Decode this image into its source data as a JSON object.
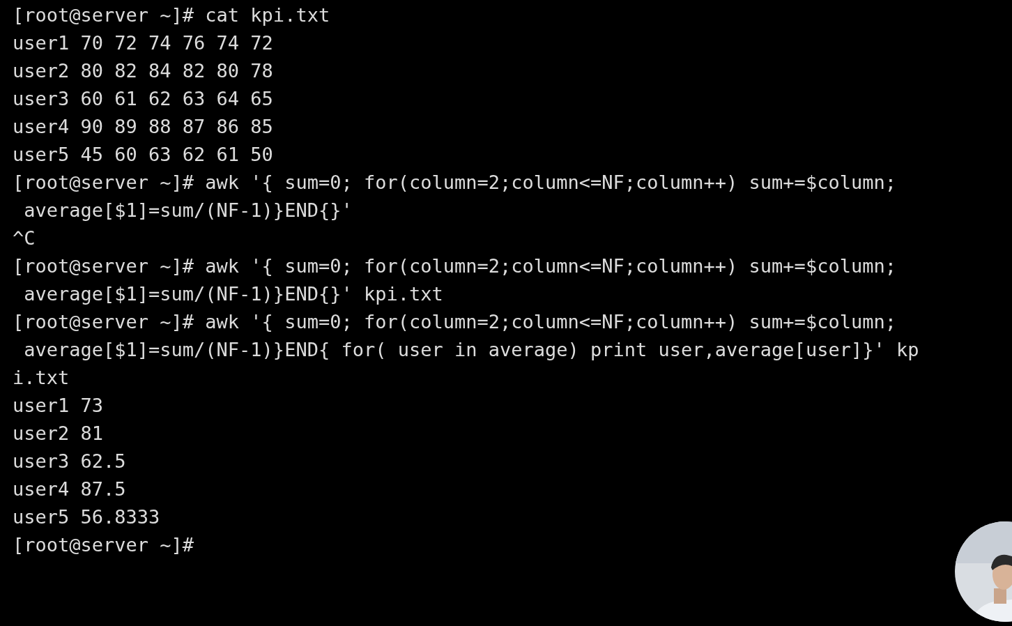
{
  "terminal": {
    "lines": [
      "[root@server ~]# cat kpi.txt",
      "user1 70 72 74 76 74 72",
      "user2 80 82 84 82 80 78",
      "user3 60 61 62 63 64 65",
      "user4 90 89 88 87 86 85",
      "user5 45 60 63 62 61 50",
      "[root@server ~]# awk '{ sum=0; for(column=2;column<=NF;column++) sum+=$column;",
      " average[$1]=sum/(NF-1)}END{}'",
      "^C",
      "[root@server ~]# awk '{ sum=0; for(column=2;column<=NF;column++) sum+=$column;",
      " average[$1]=sum/(NF-1)}END{}' kpi.txt",
      "[root@server ~]# awk '{ sum=0; for(column=2;column<=NF;column++) sum+=$column;",
      " average[$1]=sum/(NF-1)}END{ for( user in average) print user,average[user]}' kp",
      "i.txt",
      "user1 73",
      "user2 81",
      "user3 62.5",
      "user4 87.5",
      "user5 56.8333",
      "[root@server ~]#"
    ]
  }
}
